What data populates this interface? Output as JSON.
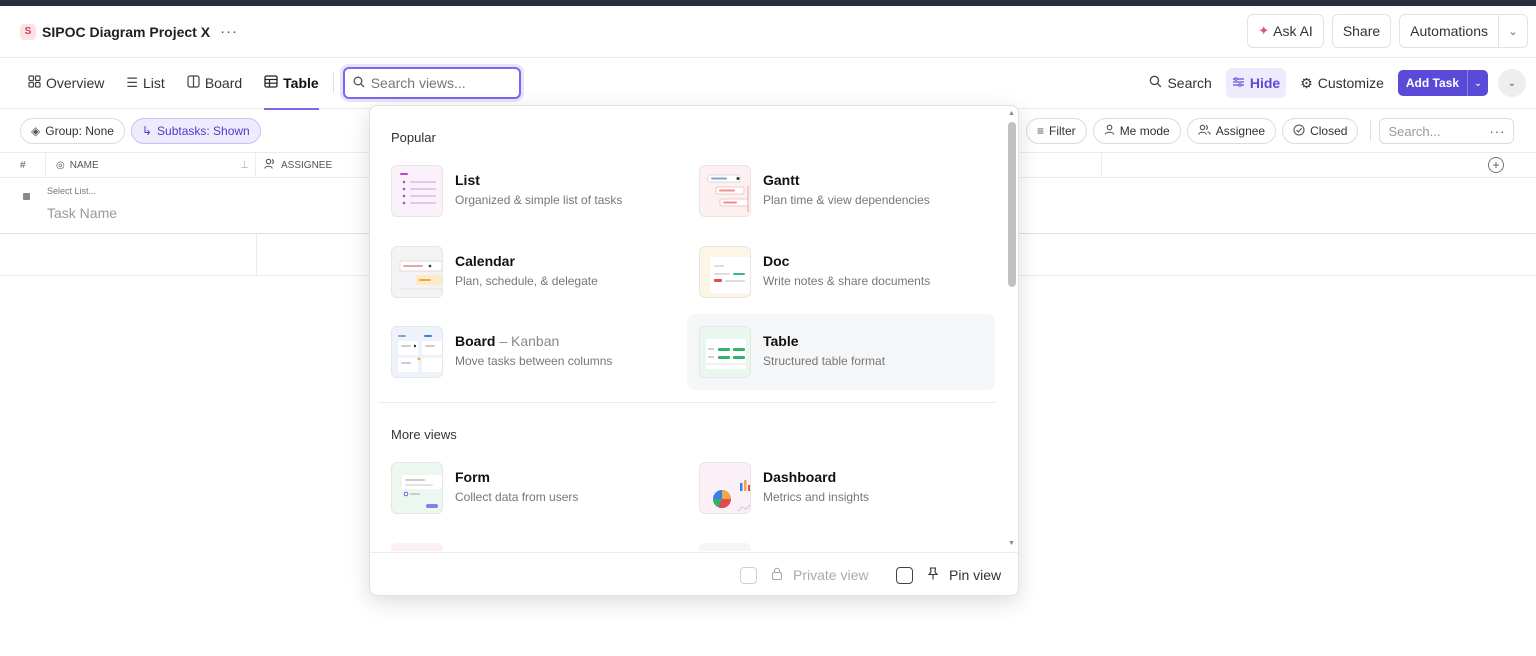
{
  "header": {
    "space_badge": "S",
    "project_title": "SIPOC Diagram Project X",
    "more": "···",
    "ask_ai": "Ask AI",
    "share": "Share",
    "automations": "Automations"
  },
  "tabs": {
    "items": [
      {
        "label": "Overview",
        "icon": "grid-icon"
      },
      {
        "label": "List",
        "icon": "list-icon"
      },
      {
        "label": "Board",
        "icon": "board-icon"
      },
      {
        "label": "Table",
        "icon": "table-icon",
        "active": true
      }
    ],
    "search_placeholder": "Search views...",
    "search_label": "Search",
    "hide_label": "Hide",
    "customize_label": "Customize",
    "add_task_label": "Add Task"
  },
  "filters": {
    "group": "Group: None",
    "subtasks": "Subtasks: Shown",
    "filter": "Filter",
    "me_mode": "Me mode",
    "assignee": "Assignee",
    "closed": "Closed",
    "search_placeholder": "Search..."
  },
  "table": {
    "hash": "#",
    "name_header": "NAME",
    "assignee_header": "ASSIGNEE",
    "row_select_list": "Select List...",
    "row_task_name": "Task Name"
  },
  "dropdown": {
    "popular_title": "Popular",
    "more_title": "More views",
    "popular": [
      {
        "title": "List",
        "subtitle": "",
        "desc": "Organized & simple list of tasks"
      },
      {
        "title": "Gantt",
        "subtitle": "",
        "desc": "Plan time & view dependencies"
      },
      {
        "title": "Calendar",
        "subtitle": "",
        "desc": "Plan, schedule, & delegate"
      },
      {
        "title": "Doc",
        "subtitle": "",
        "desc": "Write notes & share documents"
      },
      {
        "title": "Board",
        "subtitle": "– Kanban",
        "desc": "Move tasks between columns"
      },
      {
        "title": "Table",
        "subtitle": "",
        "desc": "Structured table format"
      }
    ],
    "more": [
      {
        "title": "Form",
        "desc": "Collect data from users"
      },
      {
        "title": "Dashboard",
        "desc": "Metrics and insights"
      }
    ],
    "private_view": "Private view",
    "pin_view": "Pin view"
  },
  "colors": {
    "accent": "#7b68ee",
    "add_task_bg": "#5b4ad8",
    "top_strip": "#2b2e3d"
  }
}
